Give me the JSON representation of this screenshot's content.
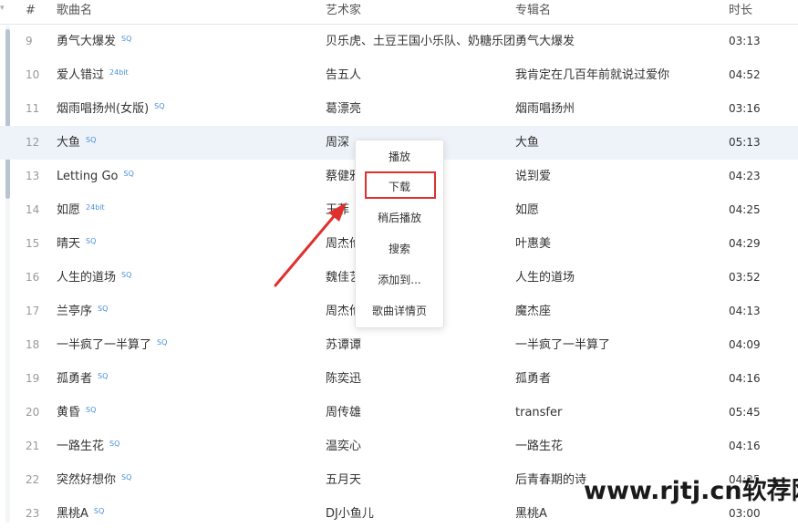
{
  "header": {
    "caret": "▾",
    "num": "#",
    "title": "歌曲名",
    "artist": "艺术家",
    "album": "专辑名",
    "duration": "时长"
  },
  "rows": [
    {
      "num": "9",
      "title": "勇气大爆发",
      "badge": "SQ",
      "artist": "贝乐虎、土豆王国小乐队、奶糖乐团",
      "album": "勇气大爆发",
      "duration": "03:13"
    },
    {
      "num": "10",
      "title": "爱人错过",
      "badge": "24bit",
      "artist": "告五人",
      "album": "我肯定在几百年前就说过爱你",
      "duration": "04:52"
    },
    {
      "num": "11",
      "title": "烟雨唱扬州(女版)",
      "badge": "SQ",
      "artist": "葛漂亮",
      "album": "烟雨唱扬州",
      "duration": "03:16"
    },
    {
      "num": "12",
      "title": "大鱼",
      "badge": "SQ",
      "artist": "周深",
      "album": "大鱼",
      "duration": "05:13"
    },
    {
      "num": "13",
      "title": "Letting Go",
      "badge": "SQ",
      "artist": "蔡健雅",
      "album": "说到爱",
      "duration": "04:23"
    },
    {
      "num": "14",
      "title": "如愿",
      "badge": "24bit",
      "artist": "王菲",
      "album": "如愿",
      "duration": "04:25"
    },
    {
      "num": "15",
      "title": "晴天",
      "badge": "SQ",
      "artist": "周杰伦",
      "album": "叶惠美",
      "duration": "04:29"
    },
    {
      "num": "16",
      "title": "人生的道场",
      "badge": "SQ",
      "artist": "魏佳艺",
      "album": "人生的道场",
      "duration": "03:52"
    },
    {
      "num": "17",
      "title": "兰亭序",
      "badge": "SQ",
      "artist": "周杰伦",
      "album": "魔杰座",
      "duration": "04:13"
    },
    {
      "num": "18",
      "title": "一半疯了一半算了",
      "badge": "SQ",
      "artist": "苏谭谭",
      "album": "一半疯了一半算了",
      "duration": "04:09"
    },
    {
      "num": "19",
      "title": "孤勇者",
      "badge": "SQ",
      "artist": "陈奕迅",
      "album": "孤勇者",
      "duration": "04:16"
    },
    {
      "num": "20",
      "title": "黄昏",
      "badge": "SQ",
      "artist": "周传雄",
      "album": "transfer",
      "duration": "05:45"
    },
    {
      "num": "21",
      "title": "一路生花",
      "badge": "SQ",
      "artist": "温奕心",
      "album": "一路生花",
      "duration": "04:16"
    },
    {
      "num": "22",
      "title": "突然好想你",
      "badge": "SQ",
      "artist": "五月天",
      "album": "后青春期的诗",
      "duration": "04:25"
    },
    {
      "num": "23",
      "title": "黑桃A",
      "badge": "SQ",
      "artist": "DJ小鱼儿",
      "album": "黑桃A",
      "duration": "03:00"
    }
  ],
  "context_menu": {
    "items": [
      "播放",
      "下载",
      "稍后播放",
      "搜索",
      "添加到...",
      "歌曲详情页"
    ],
    "highlighted": "下载",
    "highlight_color": "#e0302e"
  },
  "watermark": "www.rjtj.cn软荐网",
  "colors": {
    "hover_row": "#eef3f9",
    "badge": "#4a8fd6",
    "arrow": "#e0302e"
  }
}
